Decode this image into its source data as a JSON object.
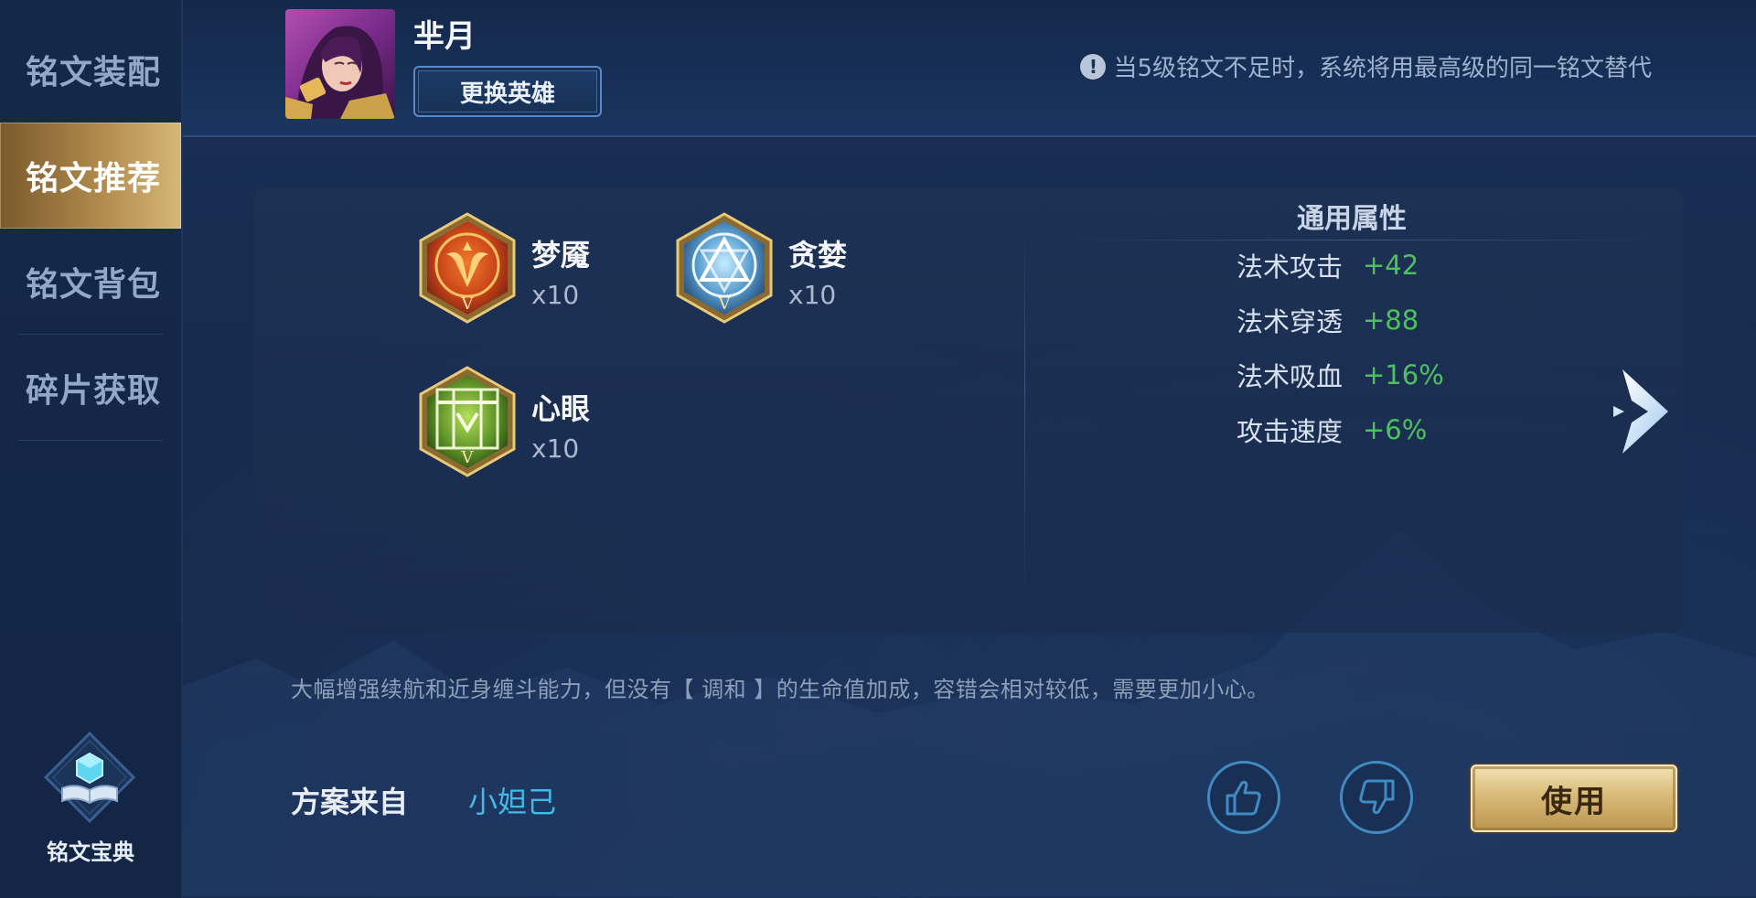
{
  "sidebar": {
    "items": [
      {
        "label": "铭文装配"
      },
      {
        "label": "铭文推荐"
      },
      {
        "label": "铭文背包"
      },
      {
        "label": "碎片获取"
      }
    ],
    "active_index": 1,
    "codex_label": "铭文宝典"
  },
  "header": {
    "hero_name": "芈月",
    "change_hero_label": "更换英雄",
    "notice": "当5级铭文不足时，系统将用最高级的同一铭文替代",
    "notice_icon": "info-icon"
  },
  "runes": [
    {
      "name": "梦魇",
      "count": "x10",
      "color": "#c9541e",
      "icon": "red-rune-emblem"
    },
    {
      "name": "贪婪",
      "count": "x10",
      "color": "#4f8fc2",
      "icon": "blue-rune-emblem"
    },
    {
      "name": "心眼",
      "count": "x10",
      "color": "#6a9a2e",
      "icon": "green-rune-emblem"
    }
  ],
  "attributes": {
    "title": "通用属性",
    "rows": [
      {
        "name": "法术攻击",
        "value": "+42"
      },
      {
        "name": "法术穿透",
        "value": "+88"
      },
      {
        "name": "法术吸血",
        "value": "+16%"
      },
      {
        "name": "攻击速度",
        "value": "+6%"
      }
    ]
  },
  "description": "大幅增强续航和近身缠斗能力，但没有【 调和 】的生命值加成，容错会相对较低，需要更加小心。",
  "source": {
    "label": "方案来自",
    "author": "小妲己"
  },
  "actions": {
    "like_icon": "thumbs-up-icon",
    "dislike_icon": "thumbs-down-icon",
    "use_label": "使用"
  },
  "colors": {
    "accent_gold": "#d8bb78",
    "value_green": "#4ec15f",
    "author_blue": "#45b9e6"
  }
}
